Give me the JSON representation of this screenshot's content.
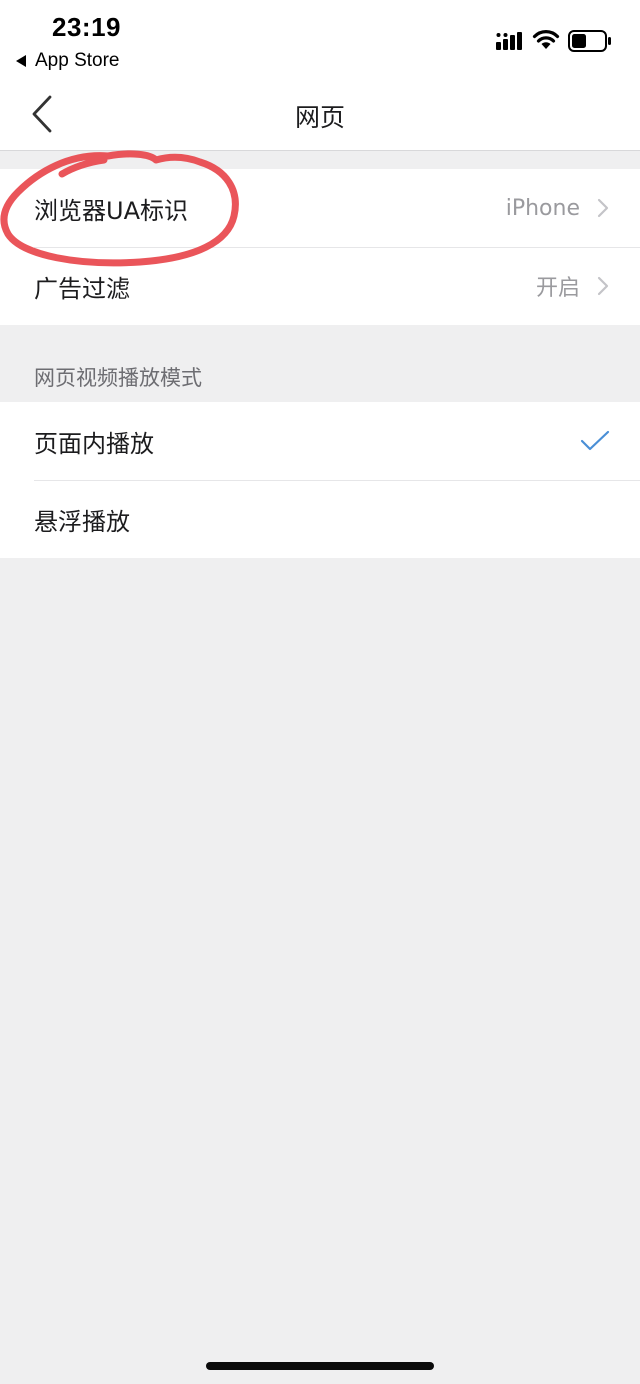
{
  "status_bar": {
    "time": "23:19",
    "back_app": "App Store",
    "icons": [
      "signal-icon",
      "wifi-icon",
      "battery-icon"
    ]
  },
  "nav": {
    "title": "网页",
    "back_icon": "chevron-left-icon"
  },
  "settings": {
    "ua_label": "浏览器UA标识",
    "ua_value": "iPhone",
    "adblock_label": "广告过滤",
    "adblock_value": "开启"
  },
  "video_mode": {
    "header": "网页视频播放模式",
    "options": [
      {
        "label": "页面内播放",
        "selected": true
      },
      {
        "label": "悬浮播放",
        "selected": false
      }
    ]
  },
  "colors": {
    "background": "#efeff0",
    "card": "#ffffff",
    "check": "#4a8fd6",
    "annotation": "#e8474c",
    "secondary_text": "#9a9a9e"
  }
}
